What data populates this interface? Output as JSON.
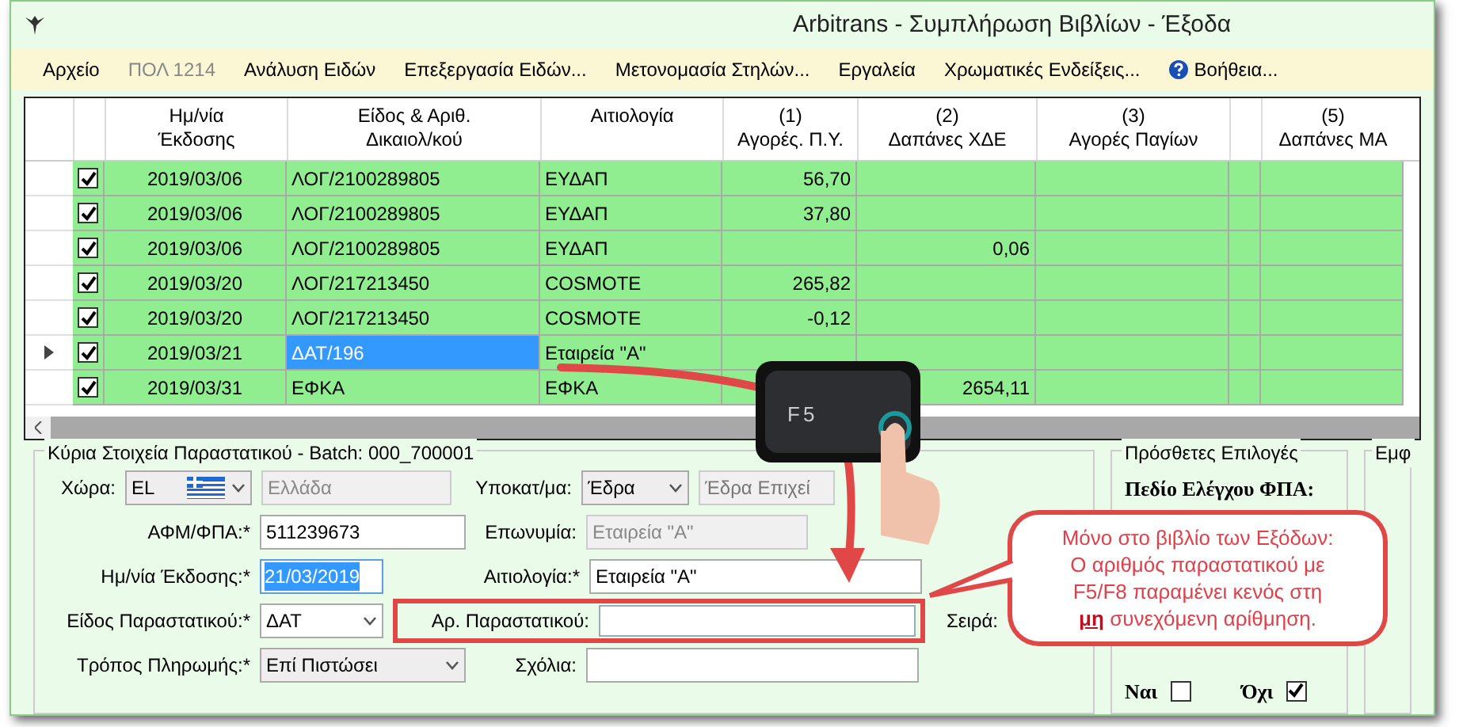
{
  "window": {
    "title": "Arbitrans - Συμπλήρωση Βιβλίων - Έξοδα"
  },
  "menu": [
    {
      "label": "Αρχείο",
      "disabled": false
    },
    {
      "label": "ΠΟΛ 1214",
      "disabled": true
    },
    {
      "label": "Ανάλυση Ειδών",
      "disabled": false
    },
    {
      "label": "Επεξεργασία Ειδών...",
      "disabled": false
    },
    {
      "label": "Μετονομασία Στηλών...",
      "disabled": false
    },
    {
      "label": "Εργαλεία",
      "disabled": false
    },
    {
      "label": "Χρωματικές Ενδείξεις...",
      "disabled": false
    },
    {
      "label": "Βοήθεια...",
      "disabled": false,
      "kind": "help"
    }
  ],
  "table": {
    "columns": [
      "Ημ/νία\nΈκδοσης",
      "Είδος & Αριθ.\nΔικαιολ/κού",
      "Αιτιολογία",
      "(1)\nΑγορές. Π.Υ.",
      "(2)\nΔαπάνες ΧΔΕ",
      "(3)\nΑγορές Παγίων",
      "",
      "(5)\nΔαπάνες ΜΑ"
    ],
    "rows": [
      {
        "current": false,
        "checked": true,
        "cells": [
          "2019/03/06",
          "ΛΟΓ/2100289805",
          "ΕΥΔΑΠ",
          "56,70",
          "",
          "",
          "",
          ""
        ]
      },
      {
        "current": false,
        "checked": true,
        "cells": [
          "2019/03/06",
          "ΛΟΓ/2100289805",
          "ΕΥΔΑΠ",
          "37,80",
          "",
          "",
          "",
          ""
        ]
      },
      {
        "current": false,
        "checked": true,
        "cells": [
          "2019/03/06",
          "ΛΟΓ/2100289805",
          "ΕΥΔΑΠ",
          "",
          "0,06",
          "",
          "",
          ""
        ]
      },
      {
        "current": false,
        "checked": true,
        "cells": [
          "2019/03/20",
          "ΛΟΓ/217213450",
          "COSMOTE",
          "265,82",
          "",
          "",
          "",
          ""
        ]
      },
      {
        "current": false,
        "checked": true,
        "cells": [
          "2019/03/20",
          "ΛΟΓ/217213450",
          "COSMOTE",
          "-0,12",
          "",
          "",
          "",
          ""
        ]
      },
      {
        "current": true,
        "checked": true,
        "cells": [
          "2019/03/21",
          "ΔΑΤ/196",
          "Εταιρεία \"Α\"",
          "",
          "",
          "",
          "",
          ""
        ]
      },
      {
        "current": false,
        "checked": true,
        "cells": [
          "2019/03/31",
          "ΕΦΚΑ",
          "ΕΦΚΑ",
          "",
          "2654,11",
          "",
          "",
          ""
        ]
      }
    ]
  },
  "form": {
    "title": "Κύρια Στοιχεία Παραστατικού - Batch: 000_700001",
    "country_label": "Χώρα:",
    "country_code": "EL",
    "country_name": "Ελλάδα",
    "branch_label": "Υποκατ/μα:",
    "branch": "Έδρα",
    "branch_name": "Έδρα Επιχεί",
    "vat_label": "ΑΦΜ/ΦΠΑ:*",
    "vat": "511239673",
    "name_label": "Επωνυμία:",
    "name": "Εταιρεία \"Α\"",
    "date_label": "Ημ/νία Έκδοσης:*",
    "date": "21/03/2019",
    "reason_label": "Αιτιολογία:*",
    "reason": "Εταιρεία \"Α\"",
    "doc_type_label": "Είδος Παραστατικού:*",
    "doc_type": "ΔΑΤ",
    "doc_no_label": "Αρ. Παραστατικού:",
    "series_label": "Σειρά:",
    "payment_label": "Τρόπος Πληρωμής:*",
    "payment": "Επί Πιστώσει",
    "comments_label": "Σχόλια:"
  },
  "options": {
    "title": "Πρόσθετες Επιλογές",
    "vat_check_label": "Πεδίο Ελέγχου ΦΠΑ:",
    "yes": {
      "label": "Ναι",
      "checked": false
    },
    "no": {
      "label": "Όχι",
      "checked": true
    }
  },
  "display_panel": {
    "title": "Εμφ"
  },
  "key": {
    "label": "F5"
  },
  "callout": {
    "text": "Μόνο στο βιβλίο των Εξόδων:\nΟ αριθμός παραστατικού με\nF5/F8 παραμένει κενός στη\n**μη** συνεχόμενη αρίθμηση."
  }
}
